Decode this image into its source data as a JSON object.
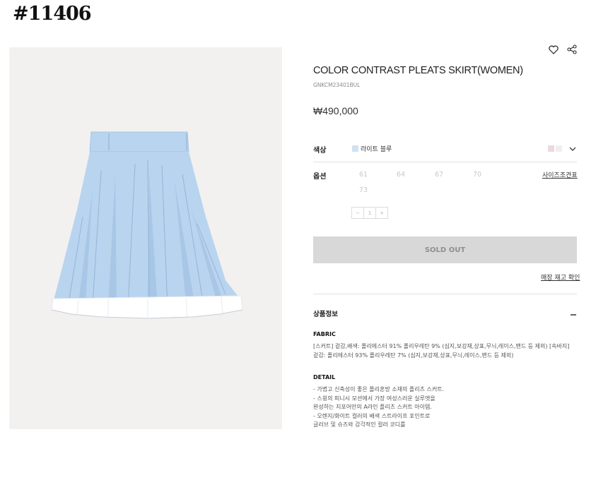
{
  "overlay_label": "#11406",
  "product": {
    "title": "COLOR CONTRAST PLEATS SKIRT(WOMEN)",
    "code": "GNKCM23401BUL",
    "price": "₩490,000"
  },
  "color_row": {
    "label": "색상",
    "selected_name": "라이트 블루",
    "selected_swatch_color": "#cfe1f2",
    "other_swatches": [
      "#ead9dd",
      "#f2eef0"
    ]
  },
  "option_row": {
    "label": "옵션",
    "sizes": [
      "61",
      "64",
      "67",
      "70",
      "73"
    ],
    "size_guide_label": "사이즈조견표",
    "stepper": {
      "minus": "−",
      "quantity": "1",
      "plus": "+"
    }
  },
  "sold_out_label": "SOLD OUT",
  "store_stock_label": "매장 재고 확인",
  "info_section": {
    "title": "상품정보",
    "toggle": "−",
    "fabric_heading": "FABRIC",
    "fabric_lines": [
      "[스커트] 겉감,배색: 폴리에스터 91% 폴리우레탄 9% (심지,보강재,상표,무늬,레이스,밴드 등 제외) [속바지]",
      "겉감: 폴리에스터 93% 폴리우레탄 7% (심지,보강재,상표,무늬,레이스,밴드 등 제외)"
    ],
    "detail_heading": "DETAIL",
    "detail_lines": [
      "- 가볍고 신축성이 좋은 폴리혼방 소재의 플리츠 스커트.",
      "- 스윙의 피니시 모션에서 가장 여성스러운 실루엣을",
      "  완성하는 지포어만의 A라인 플리츠 스커트 아이템.",
      "- 오렌지/화이트 컬러의 배색 스트라이프 포인트로",
      "  글러브 및 슈즈와 감각적인 컬러 코디를"
    ]
  },
  "colors": {
    "skirt": "#b9d4ef",
    "skirt_shadow": "#a4c2e2",
    "hem": "#ffffff",
    "button_bg": "#d8d8d8"
  }
}
